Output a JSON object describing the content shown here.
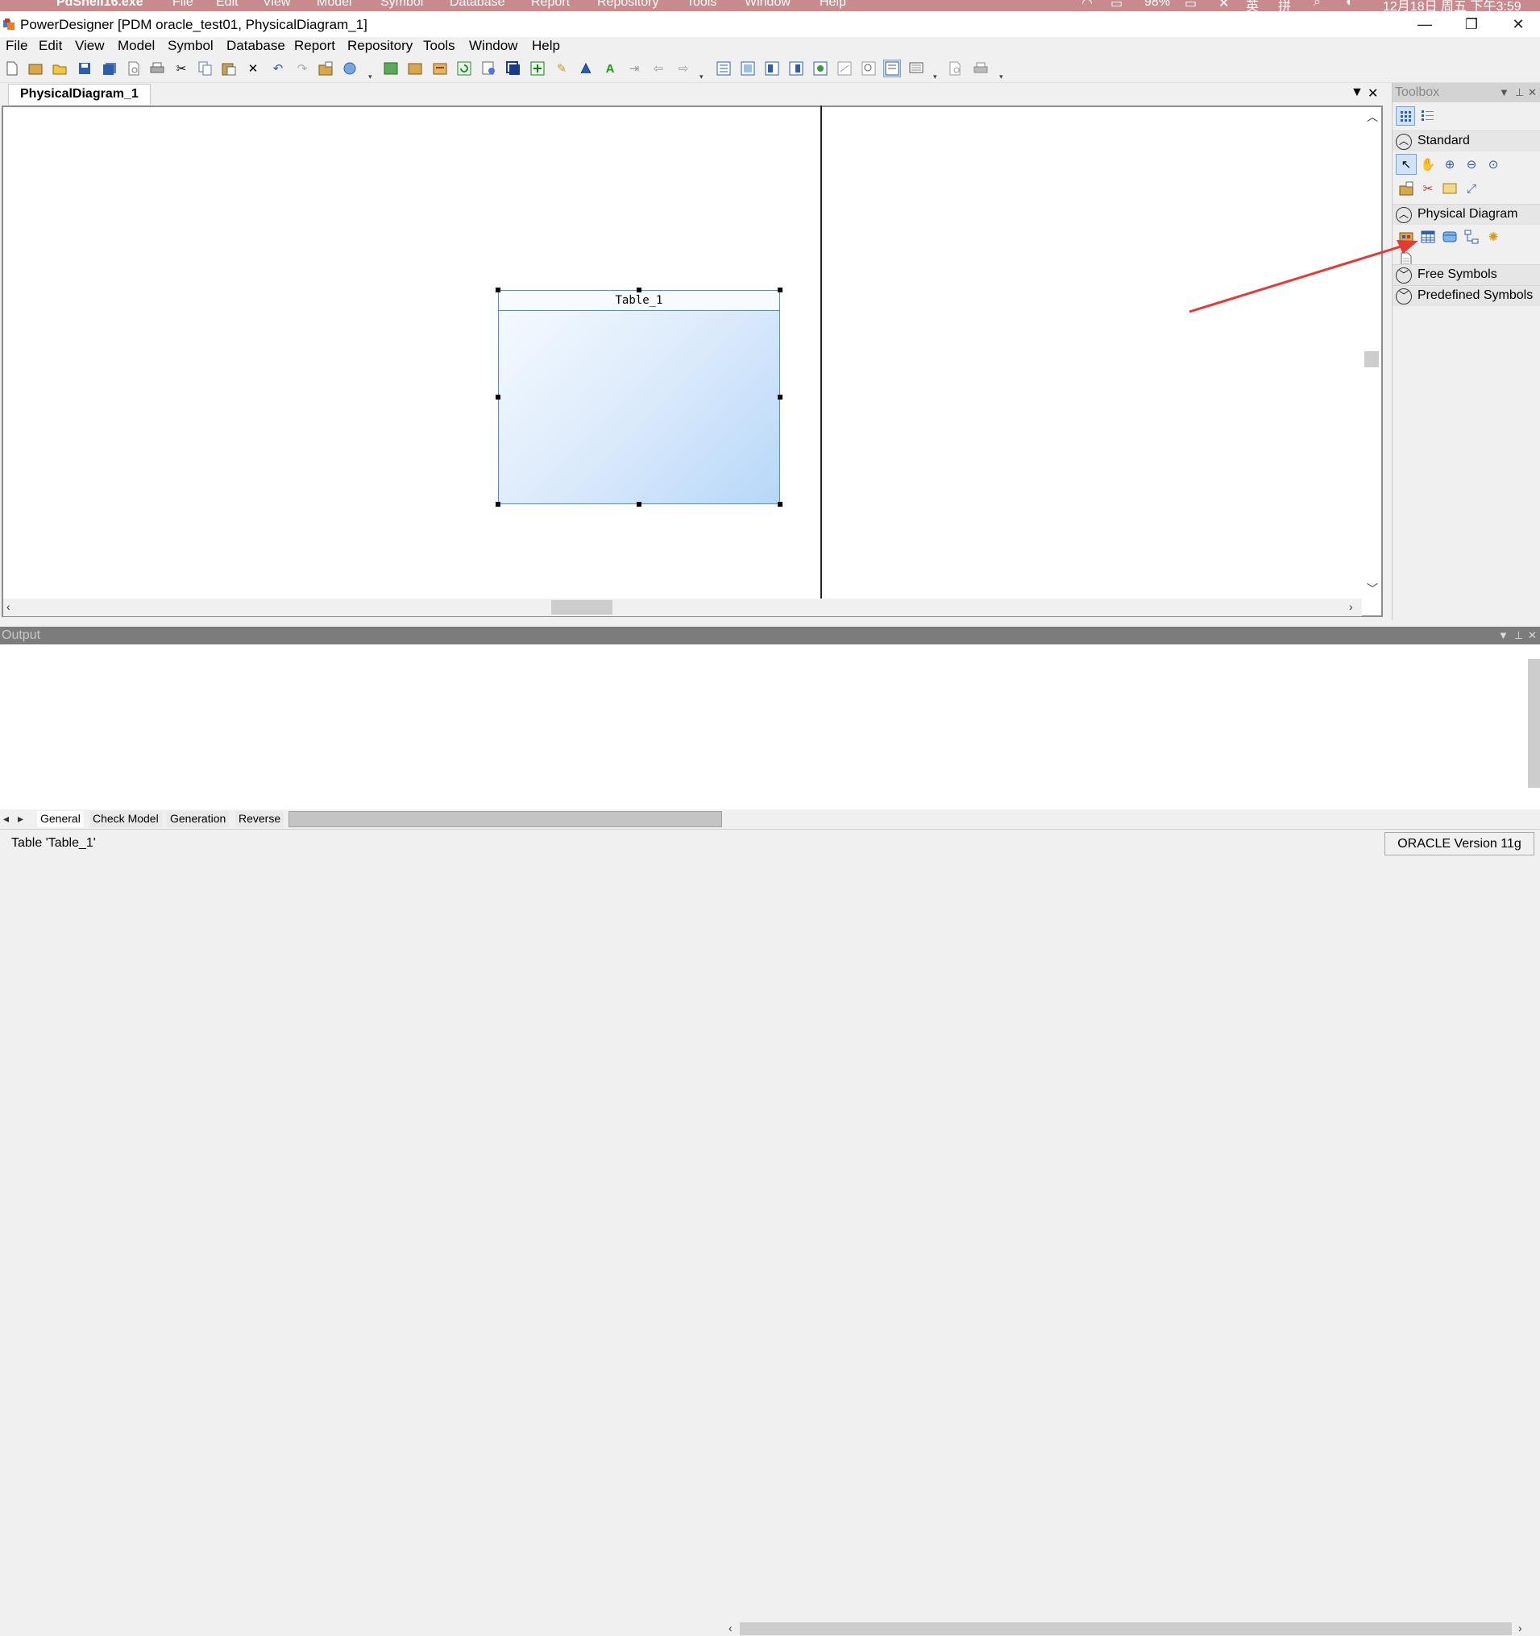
{
  "mac_menubar": {
    "items": [
      "PdShell16.exe",
      "File",
      "Edit",
      "View",
      "Model",
      "Symbol",
      "Database",
      "Report",
      "Repository",
      "Tools",
      "Window",
      "Help"
    ],
    "battery": "98%",
    "ime_1": "英",
    "ime_2": "拼",
    "clock": "12月18日 周五 下午3:59"
  },
  "window": {
    "title": "PowerDesigner [PDM oracle_test01, PhysicalDiagram_1]",
    "minimize": "—",
    "restore": "❐",
    "close": "✕"
  },
  "menu": {
    "items": [
      "File",
      "Edit",
      "View",
      "Model",
      "Symbol",
      "Database",
      "Report",
      "Repository",
      "Tools",
      "Window",
      "Help"
    ]
  },
  "toolbar": {
    "icons": [
      "new-icon",
      "new-project-icon",
      "open-icon",
      "save-icon",
      "save-all-icon",
      "print-preview-icon",
      "print-icon",
      "cut-icon",
      "copy-icon",
      "paste-icon",
      "delete-icon",
      "undo-icon",
      "redo-icon",
      "properties-icon",
      "browse-icon",
      "check-model-icon",
      "generate-icon",
      "reverse-icon",
      "update-icon",
      "impact-icon",
      "layout-icon",
      "align-icon",
      "pen-icon",
      "format-icon",
      "text-icon",
      "link-icon",
      "back-icon",
      "forward-icon",
      "view-1-icon",
      "view-2-icon",
      "view-3-icon",
      "view-4-icon",
      "view-5-icon",
      "view-6-icon",
      "view-7-icon",
      "view-8-icon",
      "view-9-icon",
      "preview-icon",
      "printer-icon"
    ]
  },
  "document": {
    "tab_label": "PhysicalDiagram_1",
    "dropdown": "▼",
    "close": "✕"
  },
  "diagram": {
    "table_name": "Table_1"
  },
  "toolbox": {
    "title": "Toolbox",
    "pin": "📌",
    "close": "✕",
    "sections": [
      {
        "label": "Standard",
        "expanded": true
      },
      {
        "label": "Physical Diagram",
        "expanded": true
      },
      {
        "label": "Free Symbols",
        "expanded": false
      },
      {
        "label": "Predefined Symbols",
        "expanded": false
      }
    ],
    "standard_tools": [
      "pointer-tool-icon",
      "grabber-tool-icon",
      "zoom-in-tool-icon",
      "zoom-out-tool-icon",
      "open-package-tool-icon",
      "properties-tool-icon",
      "delete-tool-icon",
      "note-tool-icon",
      "link-tool-icon"
    ],
    "physical_tools": [
      "package-tool-icon",
      "table-tool-icon",
      "view-tool-icon",
      "reference-tool-icon",
      "procedure-tool-icon",
      "file-tool-icon"
    ]
  },
  "output": {
    "title": "Output",
    "tabs": [
      "General",
      "Check Model",
      "Generation",
      "Reverse"
    ],
    "active_tab": "General"
  },
  "status": {
    "message": "Table 'Table_1'",
    "dbms": "ORACLE Version 11g"
  },
  "colors": {
    "annotation_arrow": "#e53935",
    "table_border": "#4a8ed8",
    "mac_bar": "#c98a8e"
  }
}
